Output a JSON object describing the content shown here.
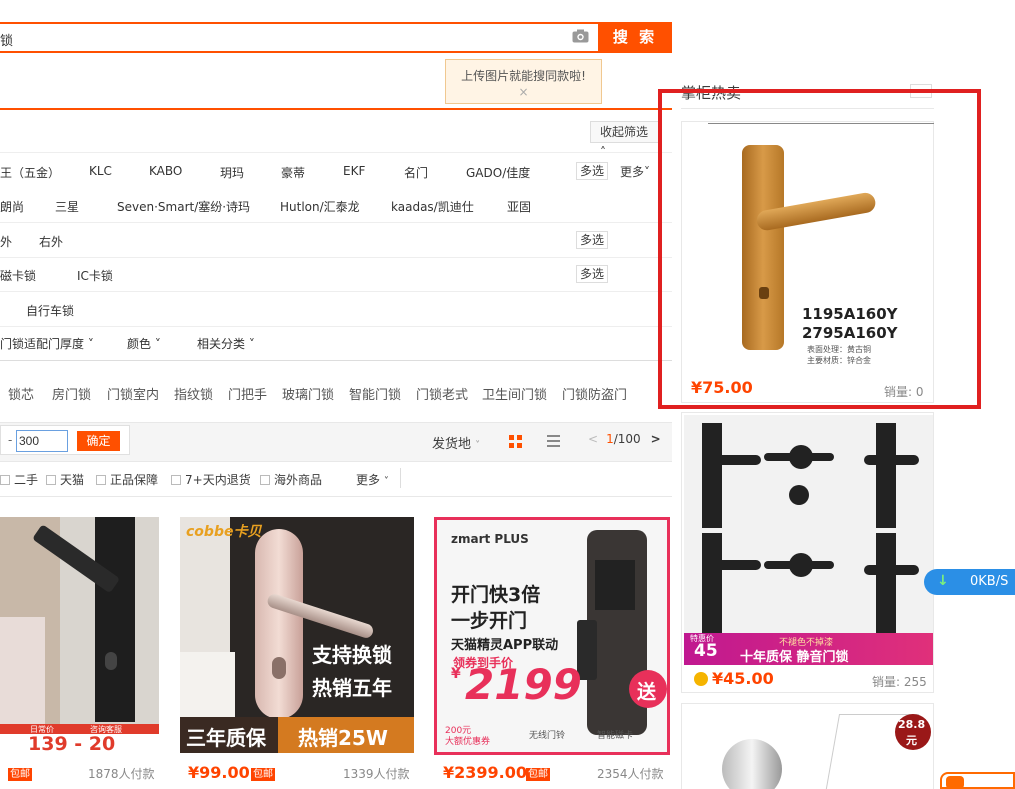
{
  "search": {
    "query_fragment": "锁",
    "button_label": "搜 索",
    "tooltip_text": "上传图片就能搜同款啦!",
    "tooltip_close": "×"
  },
  "filters": {
    "collapse_label": "收起筛选",
    "multi_select_label": "多选",
    "more_label": "更多",
    "brands_row1": [
      "王（五金）",
      "KLC",
      "KABO",
      "玥玛",
      "豪蒂",
      "EKF",
      "名门",
      "GADO/佳度"
    ],
    "brands_row2": [
      "朗尚",
      "三星",
      "Seven·Smart/塞纷·诗玛",
      "Hutlon/汇泰龙",
      "kaadas/凯迪仕",
      "亚固"
    ],
    "row3": [
      "外",
      "右外"
    ],
    "row4": [
      "磁卡锁",
      "IC卡锁"
    ],
    "row5": [
      "自行车锁"
    ],
    "row6": [
      "门锁适配门厚度",
      "颜色",
      "相关分类"
    ]
  },
  "related": [
    "锁芯",
    "房门锁",
    "门锁室内",
    "指纹锁",
    "门把手",
    "玻璃门锁",
    "智能门锁",
    "门锁老式",
    "卫生间门锁",
    "门锁防盗门"
  ],
  "sortbar": {
    "price_dash": "-",
    "price_to": "300",
    "confirm_label": "确定",
    "ship_from_label": "发货地",
    "page_current": "1",
    "page_total": "/100"
  },
  "checkbox_filters": [
    "二手",
    "天猫",
    "正品保障",
    "7+天内退货",
    "海外商品"
  ],
  "checkbox_more": "更多",
  "products": [
    {
      "price": "",
      "free_ship": "包邮",
      "sales": "1878人付款",
      "banner_left": "日常价",
      "banner_right": "咨询客服",
      "banner_nums": "139 - 20"
    },
    {
      "price": "¥99.00",
      "free_ship": "包邮",
      "sales": "1339人付款",
      "brand_text": "cobbe卡贝",
      "promo1": "支持换锁",
      "promo2": "热销五年",
      "bottom_left": "三年质保",
      "bottom_right": "热销25W"
    },
    {
      "price": "¥2399.00",
      "free_ship": "包邮",
      "sales": "2354人付款",
      "brand_text": "zmart PLUS",
      "line1": "开门快3倍",
      "line2": "一步开门",
      "line3": "天猫精灵APP联动",
      "line4": "领券到手价",
      "big_price": "2199",
      "corner": "送",
      "foot1": "200元",
      "foot2": "大额优惠券",
      "foot3": "无线门铃",
      "foot4": "智能磁卡"
    }
  ],
  "hot": {
    "title": "掌柜热卖",
    "items": [
      {
        "price": "¥75.00",
        "sales": "销量: 0",
        "model1": "1195A160Y",
        "model2": "2795A160Y",
        "spec1": "表面处理：黄古铜",
        "spec2": "主要材质：锌合金"
      },
      {
        "price": "¥45.00",
        "sales": "销量: 255",
        "promo_tag": "特惠价",
        "promo_num": "45",
        "promo_line1": "不褪色不掉漆",
        "promo_line2": "十年质保 静音门锁"
      },
      {
        "badge_num": "28.8",
        "badge_unit": "元"
      }
    ]
  },
  "speed_widget": "0KB/S",
  "colors": {
    "accent": "#ff5000",
    "frame": "#e02020",
    "price": "#ff4400"
  }
}
